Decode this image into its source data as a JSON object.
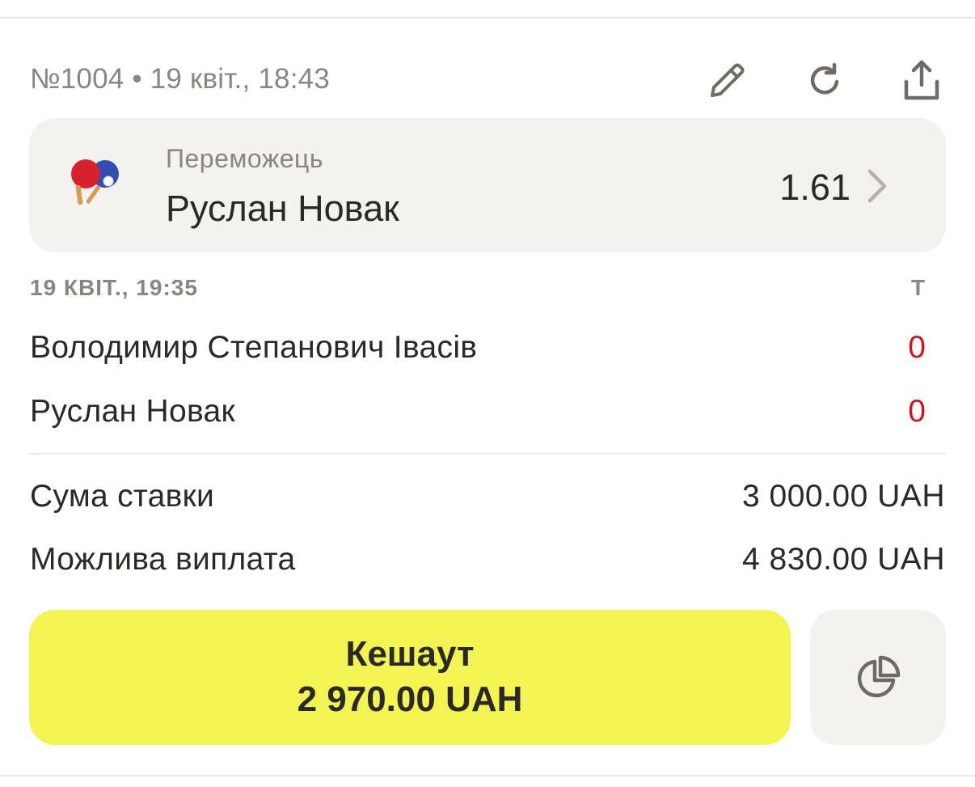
{
  "bet": {
    "meta": "№1004 • 19 квіт., 18:43"
  },
  "header": {
    "icons": [
      "edit-pencil-icon",
      "refresh-icon",
      "share-icon"
    ]
  },
  "selection": {
    "market": "Переможець",
    "name": "Руслан Новак",
    "odds": "1.61",
    "sport_icon": "table-tennis-icon"
  },
  "event": {
    "time": "19 КВІТ., 19:35",
    "score_column": "Т",
    "players": [
      {
        "name": "Володимир Степанович Івасів",
        "score": "0"
      },
      {
        "name": "Руслан Новак",
        "score": "0"
      }
    ]
  },
  "summary": {
    "stake_label": "Сума ставки",
    "stake_value": "3 000.00 UAH",
    "payout_label": "Можлива виплата",
    "payout_value": "4 830.00 UAH"
  },
  "cashout": {
    "label": "Кешаут",
    "amount": "2 970.00 UAH",
    "partial_icon": "pie-chart-icon"
  },
  "colors": {
    "accent_yellow": "#f1f453",
    "card_bg": "#f3f2ef",
    "score_red": "#d0141c",
    "muted_text": "#8a8580",
    "primary_text": "#2b2926"
  }
}
